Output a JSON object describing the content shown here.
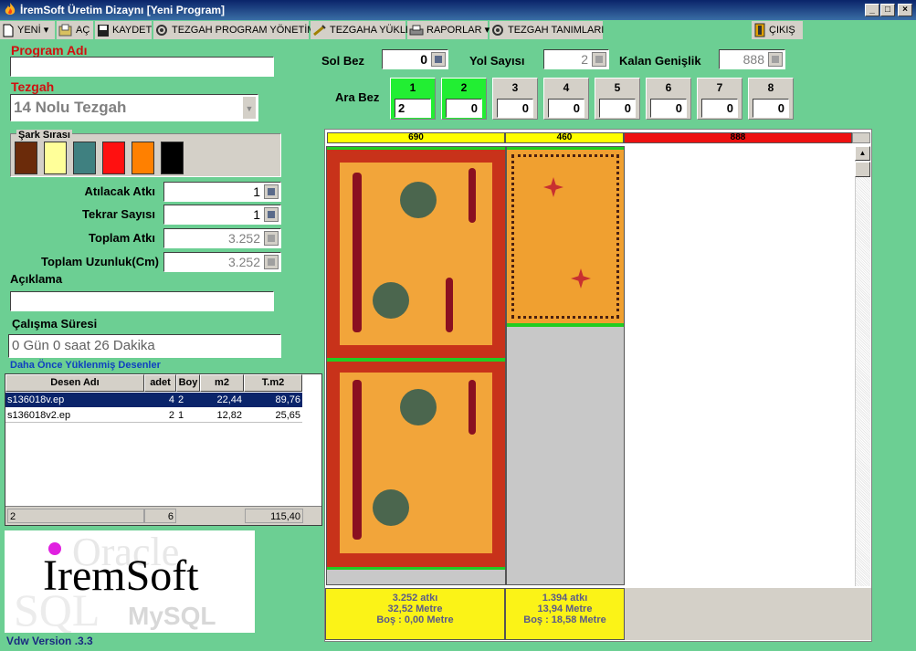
{
  "window": {
    "title": "İremSoft Üretim Dizaynı [Yeni Program]"
  },
  "menu": [
    {
      "label": "YENİ",
      "icon": "new-file-icon",
      "dropdown": true
    },
    {
      "label": "AÇ",
      "icon": "open-icon"
    },
    {
      "label": "KAYDET",
      "icon": "save-icon"
    },
    {
      "label": "TEZGAH PROGRAM YÖNETİMİ",
      "icon": "gear-icon"
    },
    {
      "label": "TEZGAHA YÜKLE",
      "icon": "upload-icon"
    },
    {
      "label": "RAPORLAR",
      "icon": "printer-icon",
      "dropdown": true
    },
    {
      "label": "TEZGAH TANIMLARI",
      "icon": "gear-icon"
    },
    {
      "label": "ÇIKIŞ",
      "icon": "exit-door-icon"
    }
  ],
  "form": {
    "program_label": "Program Adı",
    "program_value": "",
    "tezgah_label": "Tezgah",
    "tezgah_value": "14 Nolu Tezgah",
    "sark_label": "Şark Sırası",
    "sark_colors": [
      "#6b2b0a",
      "#ffff99",
      "#3f8080",
      "#ff1010",
      "#ff8000",
      "#000000"
    ],
    "atilacak_label": "Atılacak Atkı",
    "atilacak_value": "1",
    "tekrar_label": "Tekrar Sayısı",
    "tekrar_value": "1",
    "toplam_atki_label": "Toplam Atkı",
    "toplam_atki_value": "3.252",
    "toplam_uzunluk_label": "Toplam Uzunluk(Cm)",
    "toplam_uzunluk_value": "3.252",
    "aciklama_label": "Açıklama",
    "aciklama_value": "",
    "calisma_label": "Çalışma Süresi",
    "calisma_value": "0 Gün 0 saat 26 Dakika",
    "desenler_label": "Daha Önce Yüklenmiş Desenler"
  },
  "table": {
    "columns": [
      "Desen Adı",
      "adet",
      "Boy",
      "m2",
      "T.m2"
    ],
    "rows": [
      [
        "s136018v.ep",
        "4",
        "2",
        "22,44",
        "89,76"
      ],
      [
        "s136018v2.ep",
        "2",
        "1",
        "12,82",
        "25,65"
      ]
    ],
    "footer": [
      "2",
      "6",
      "115,40"
    ]
  },
  "logo": {
    "text": "IremSoft",
    "bg_words": [
      "Oracle",
      "SQL",
      "MySQL"
    ]
  },
  "version": "Vdw Version .3.3",
  "top": {
    "sol_bez_label": "Sol Bez",
    "sol_bez_value": "0",
    "yol_label": "Yol Sayısı",
    "yol_value": "2",
    "kalan_label": "Kalan Genişlik",
    "kalan_value": "888",
    "ara_bez_label": "Ara Bez",
    "ara_bez": [
      {
        "n": "1",
        "v": "2",
        "active": true
      },
      {
        "n": "2",
        "v": "0",
        "active": true
      },
      {
        "n": "3",
        "v": "0"
      },
      {
        "n": "4",
        "v": "0"
      },
      {
        "n": "5",
        "v": "0"
      },
      {
        "n": "6",
        "v": "0"
      },
      {
        "n": "7",
        "v": "0"
      },
      {
        "n": "8",
        "v": "0"
      }
    ]
  },
  "canvas": {
    "widths": [
      "690",
      "460",
      "888"
    ],
    "stats": [
      {
        "atki": "3.252 atkı",
        "metre": "32,52 Metre",
        "bos": "Boş : 0,00 Metre"
      },
      {
        "atki": "1.394 atkı",
        "metre": "13,94 Metre",
        "bos": "Boş : 18,58 Metre"
      }
    ]
  }
}
